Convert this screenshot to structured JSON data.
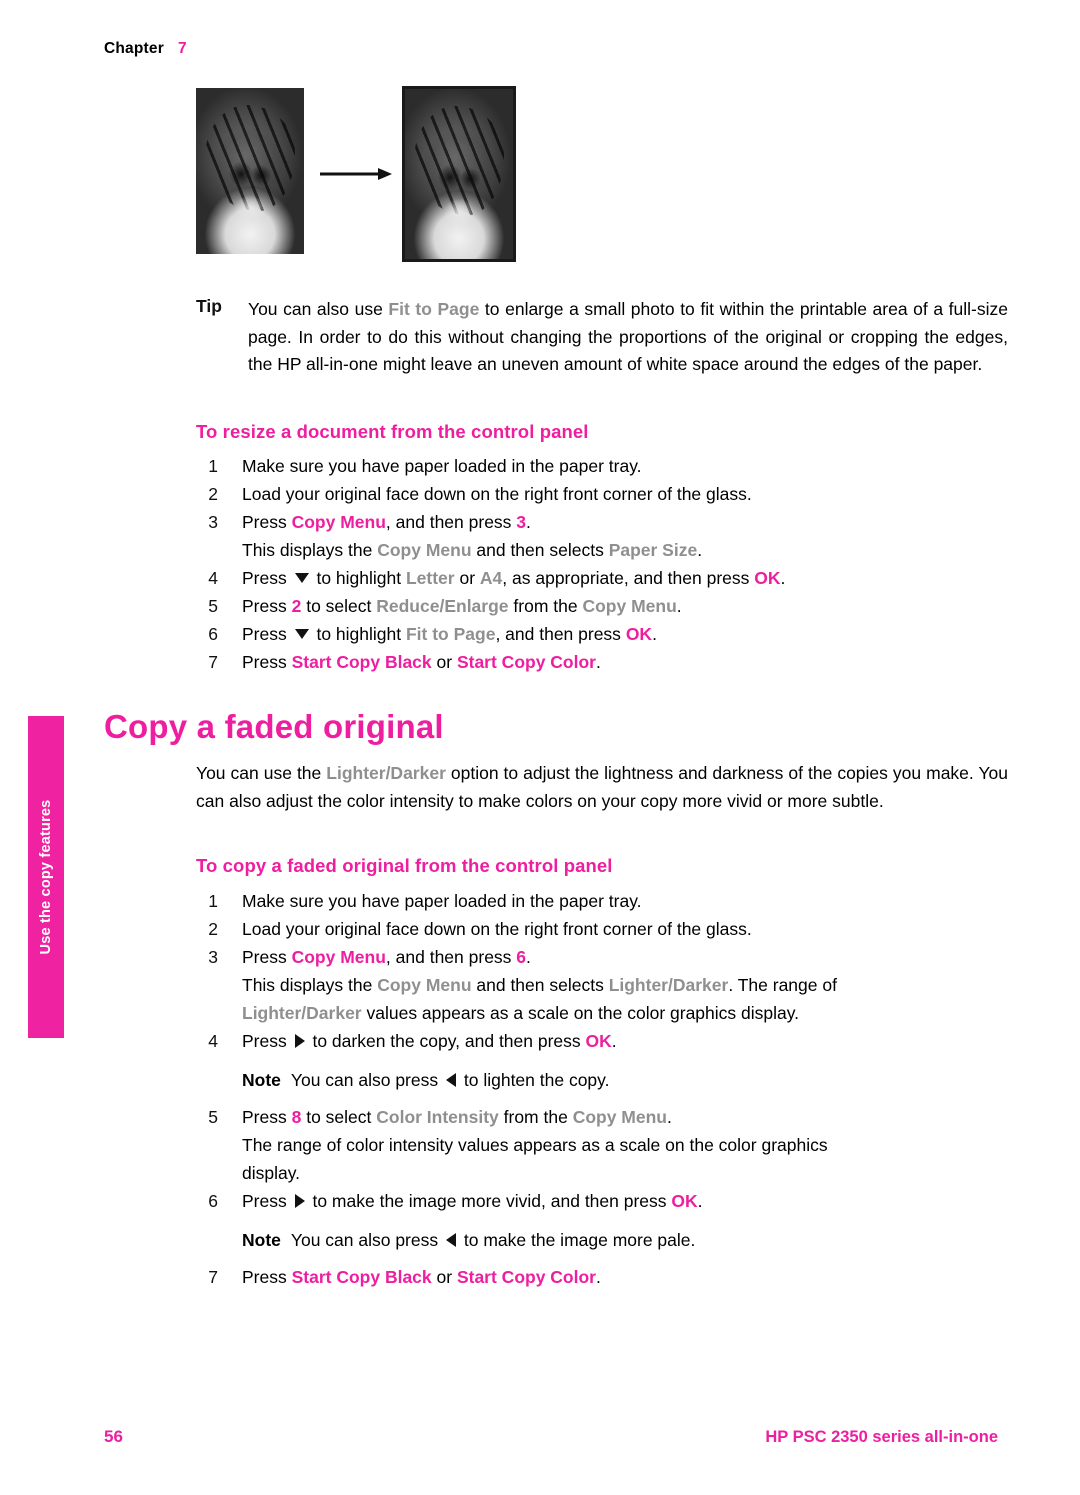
{
  "header": {
    "chapter_label": "Chapter",
    "chapter_number": "7"
  },
  "side_tab": {
    "label": "Use the copy features",
    "color": "#ef22a2"
  },
  "figure": {
    "caption_alt_small": "tiger photo original",
    "caption_alt_large": "tiger photo enlarged with border",
    "arrow": "right-arrow"
  },
  "tip": {
    "label": "Tip",
    "line1_a": "You can also use ",
    "line1_b": "Fit to Page",
    "line1_c": " to enlarge a small photo to fit within the printable",
    "line2": "area of a full-size page. In order to do this without changing the proportions of the",
    "line3": "original or cropping the edges, the HP all-in-one might leave an uneven amount of",
    "line4": "white space around the edges of the paper."
  },
  "section1": {
    "heading": "To resize a document from the control panel",
    "steps": [
      {
        "num": "1",
        "text": "Make sure you have paper loaded in the paper tray."
      },
      {
        "num": "2",
        "text": "Load your original face down on the right front corner of the glass."
      },
      {
        "num": "3",
        "text": "Press Copy Menu, and then press 3.",
        "sub": "This displays the Copy Menu and then selects Paper Size."
      },
      {
        "num": "4",
        "text": "Press ▼ to highlight Letter or A4, as appropriate, and then press OK."
      },
      {
        "num": "5",
        "text": "Press 2 to select Reduce/Enlarge from the Copy Menu."
      },
      {
        "num": "6",
        "text": "Press ▼ to highlight Fit to Page, and then press OK."
      },
      {
        "num": "7",
        "text": "Press Start Copy Black or Start Copy Color."
      }
    ],
    "tokens": {
      "press": "Press",
      "copy_menu": "Copy Menu",
      "and_then_press": ", and then press ",
      "three": "3",
      "displays_a": "This displays the ",
      "displays_b": " and then selects ",
      "paper_size": "Paper Size",
      "to_highlight": " to highlight ",
      "letter": "Letter",
      "or": " or ",
      "a4": "A4",
      "as_appropriate": ", as appropriate, and then press ",
      "ok": "OK",
      "two": "2",
      "to_select": " to select ",
      "reduce_enlarge": "Reduce/Enlarge",
      "from_the": " from the ",
      "fit_to_page": "Fit to Page",
      "and_then_press2": ", and then press ",
      "start_copy_black": "Start Copy Black",
      "or2": " or ",
      "start_copy_color": "Start Copy Color",
      "period": "."
    }
  },
  "section2": {
    "title": "Copy a faded original",
    "intro_line1_a": "You can use the ",
    "intro_line1_b": "Lighter/Darker",
    "intro_line1_c": " option to adjust the lightness and darkness of the",
    "intro_line2": "copies you make. You can also adjust the color intensity to make colors on your copy",
    "intro_line3": "more vivid or more subtle.",
    "heading": "To copy a faded original from the control panel",
    "steps": [
      {
        "num": "1",
        "text": "Make sure you have paper loaded in the paper tray."
      },
      {
        "num": "2",
        "text": "Load your original face down on the right front corner of the glass."
      },
      {
        "num": "3",
        "text": "Press Copy Menu, and then press 6."
      },
      {
        "num": "4",
        "text": "Press ▶ to darken the copy, and then press OK."
      },
      {
        "num": "5",
        "text": "Press 8 to select Color Intensity from the Copy Menu."
      },
      {
        "num": "6",
        "text": "Press ▶ to make the image more vivid, and then press OK."
      },
      {
        "num": "7",
        "text": "Press Start Copy Black or Start Copy Color."
      }
    ],
    "tokens": {
      "six": "6",
      "displays_a": "This displays the ",
      "copy_menu": "Copy Menu",
      "displays_b": " and then selects ",
      "lighter_darker": "Lighter/Darker",
      "range_of": ". The range of",
      "values_line": " values appears as a scale on the color graphics display.",
      "to_darken": " to darken the copy, and then press ",
      "ok": "OK",
      "note_label": "Note",
      "note1": "You can also press",
      "note1_end": "to lighten the copy.",
      "eight": "8",
      "to_select": " to select ",
      "color_intensity": "Color Intensity",
      "from_the": " from the ",
      "range_line1": "The range of color intensity values appears as a scale on the color graphics",
      "range_line2": "display.",
      "to_vivid": " to make the image more vivid, and then press ",
      "note2": "You can also press",
      "note2_end": "to make the image more pale.",
      "start_copy_black": "Start Copy Black",
      "or": " or ",
      "start_copy_color": "Start Copy Color",
      "period": ".",
      "press": "Press"
    }
  },
  "footer": {
    "page_number": "56",
    "product": "HP PSC 2350 series all-in-one"
  },
  "colors": {
    "magenta": "#ee1ea0",
    "gray_ui": "#8f8f8f"
  }
}
